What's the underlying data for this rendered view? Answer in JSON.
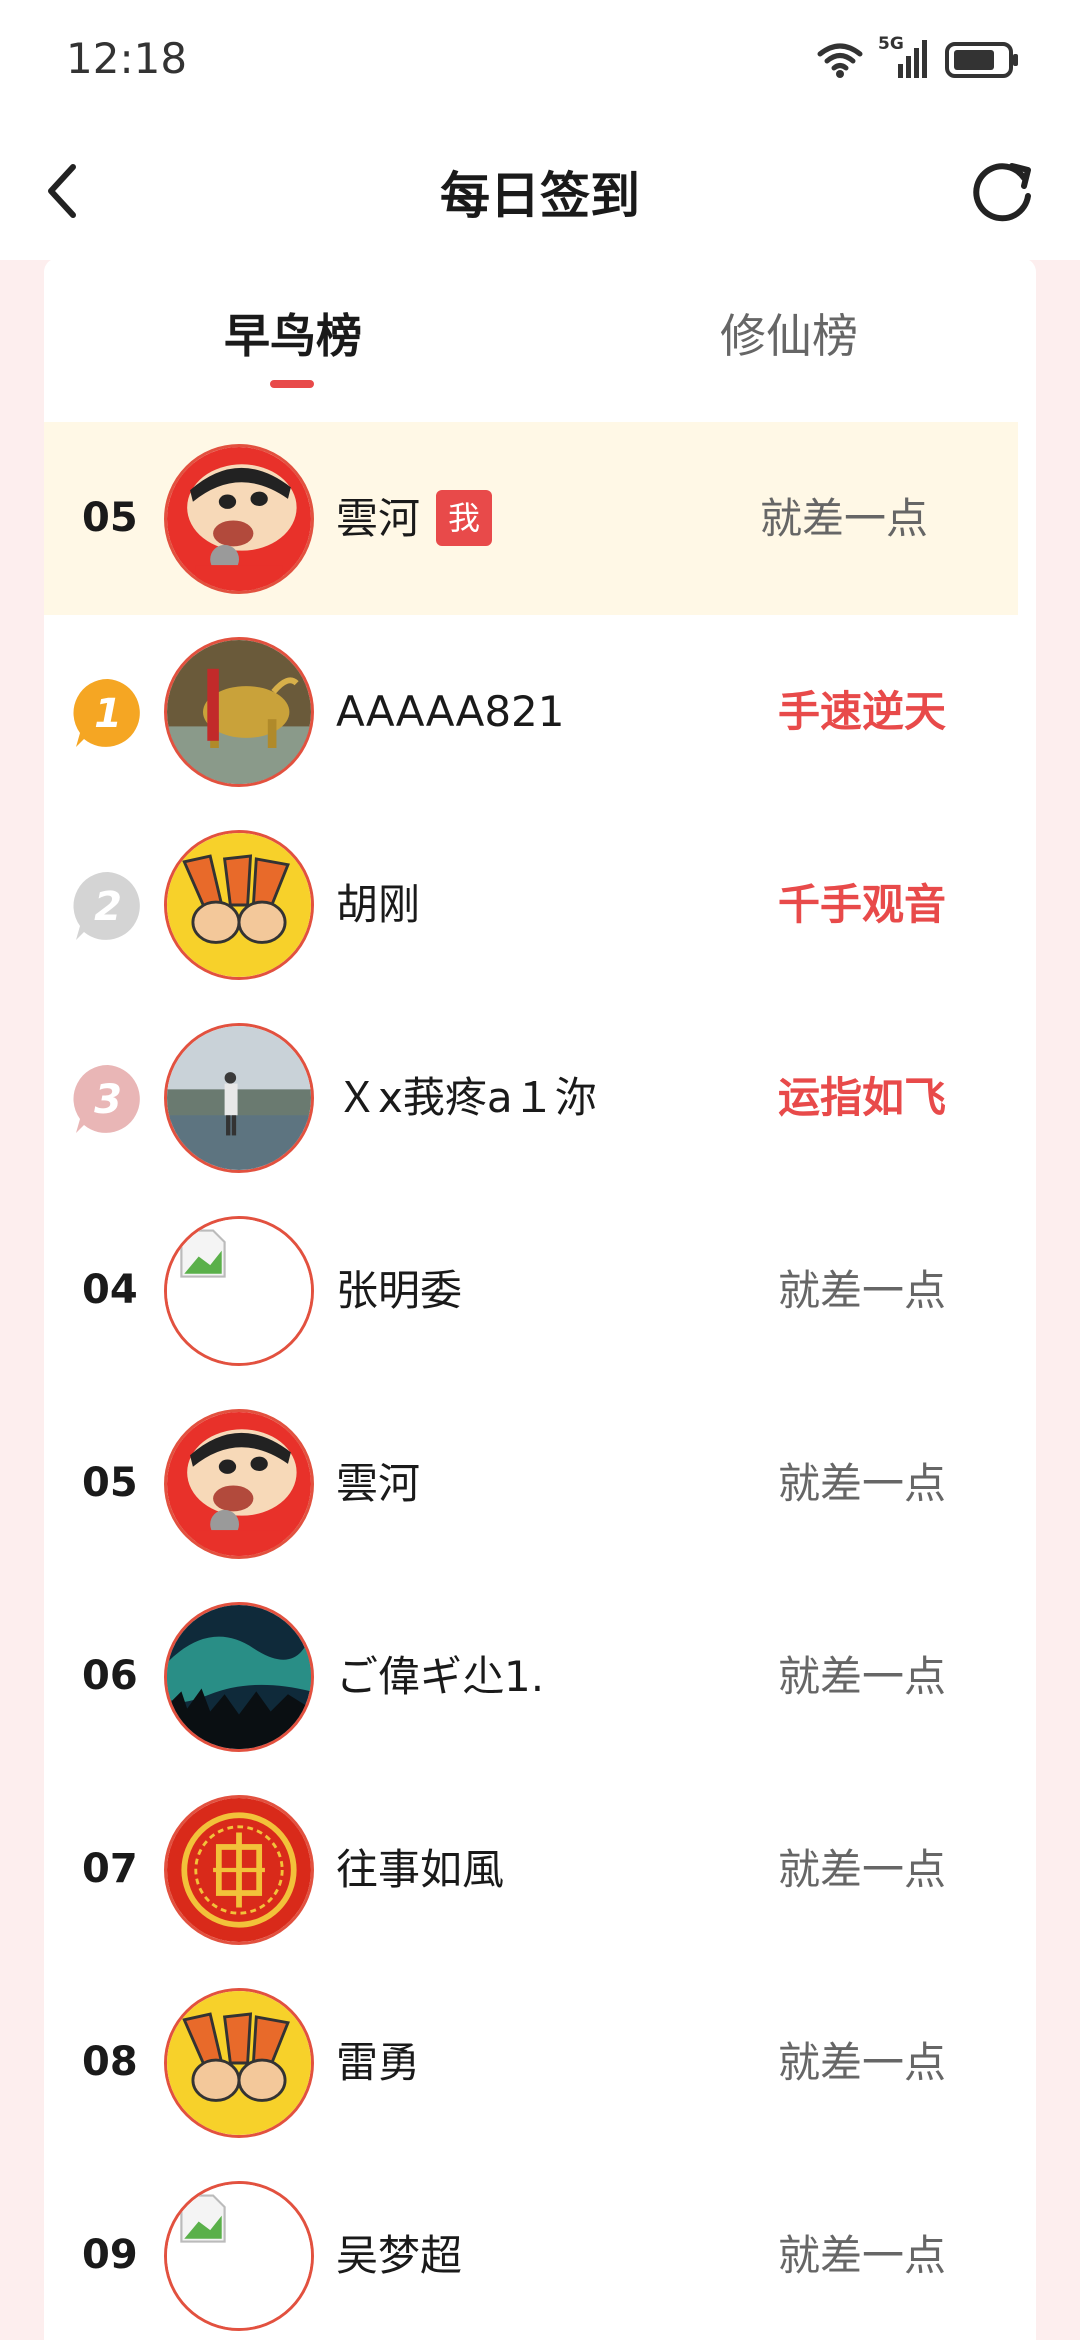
{
  "status_bar": {
    "time": "12:18",
    "network": "5G"
  },
  "header": {
    "title": "每日签到"
  },
  "tabs": [
    {
      "label": "早鸟榜",
      "active": true
    },
    {
      "label": "修仙榜",
      "active": false
    }
  ],
  "colors": {
    "accent": "#e84a4a",
    "highlight_row": "#fff8e6",
    "gold": "#f5a623",
    "silver": "#d4d4d4",
    "bronze": "#e9b6b6"
  },
  "my_row": {
    "rank": "05",
    "name": "雲河",
    "me_label": "我",
    "status": "就差一点",
    "avatar_icon": "cartoon-boy-avatar"
  },
  "ranking": [
    {
      "rank_icon": "gold-medal-1-icon",
      "name": "AAAAA821",
      "status": "手速逆天",
      "hot": true,
      "avatar_icon": "golden-bull-avatar"
    },
    {
      "rank_icon": "silver-medal-2-icon",
      "name": "胡刚",
      "status": "千手观音",
      "hot": true,
      "avatar_icon": "victory-hands-avatar"
    },
    {
      "rank_icon": "bronze-medal-3-icon",
      "name": "Ｘx莪疼a１沵",
      "status": "运指如飞",
      "hot": true,
      "avatar_icon": "lake-person-avatar"
    },
    {
      "rank": "04",
      "name": "张明委",
      "status": "就差一点",
      "hot": false,
      "avatar_icon": "broken-image-avatar"
    },
    {
      "rank": "05",
      "name": "雲河",
      "status": "就差一点",
      "hot": false,
      "avatar_icon": "cartoon-boy-avatar"
    },
    {
      "rank": "06",
      "name": "ご偉ギ尐1.",
      "status": "就差一点",
      "hot": false,
      "avatar_icon": "aurora-avatar"
    },
    {
      "rank": "07",
      "name": "往事如風",
      "status": "就差一点",
      "hot": false,
      "avatar_icon": "red-seal-avatar"
    },
    {
      "rank": "08",
      "name": "雷勇",
      "status": "就差一点",
      "hot": false,
      "avatar_icon": "victory-hands-avatar"
    },
    {
      "rank": "09",
      "name": "吴梦超",
      "status": "就差一点",
      "hot": false,
      "avatar_icon": "broken-image-avatar"
    }
  ]
}
